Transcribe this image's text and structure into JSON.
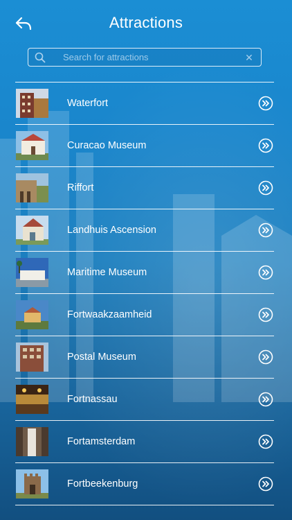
{
  "header": {
    "title": "Attractions",
    "back_icon": "back-arrow-icon"
  },
  "search": {
    "placeholder": "Search for attractions",
    "value": "",
    "icon": "search-icon",
    "clear_icon": "clear-icon"
  },
  "colors": {
    "background_top": "#1b8ed4",
    "background_bottom": "#124f80",
    "text": "#ffffff"
  },
  "attractions": [
    {
      "name": "Waterfort",
      "thumb": "waterfort-photo"
    },
    {
      "name": "Curacao Museum",
      "thumb": "curacao-museum-photo"
    },
    {
      "name": "Riffort",
      "thumb": "riffort-photo"
    },
    {
      "name": "Landhuis Ascension",
      "thumb": "landhuis-ascension-photo"
    },
    {
      "name": "Maritime Museum",
      "thumb": "maritime-museum-photo"
    },
    {
      "name": "Fortwaakzaamheid",
      "thumb": "fortwaakzaamheid-photo"
    },
    {
      "name": "Postal Museum",
      "thumb": "postal-museum-photo"
    },
    {
      "name": "Fortnassau",
      "thumb": "fortnassau-photo"
    },
    {
      "name": "Fortamsterdam",
      "thumb": "fortamsterdam-photo"
    },
    {
      "name": "Fortbeekenburg",
      "thumb": "fortbeekenburg-photo"
    }
  ]
}
